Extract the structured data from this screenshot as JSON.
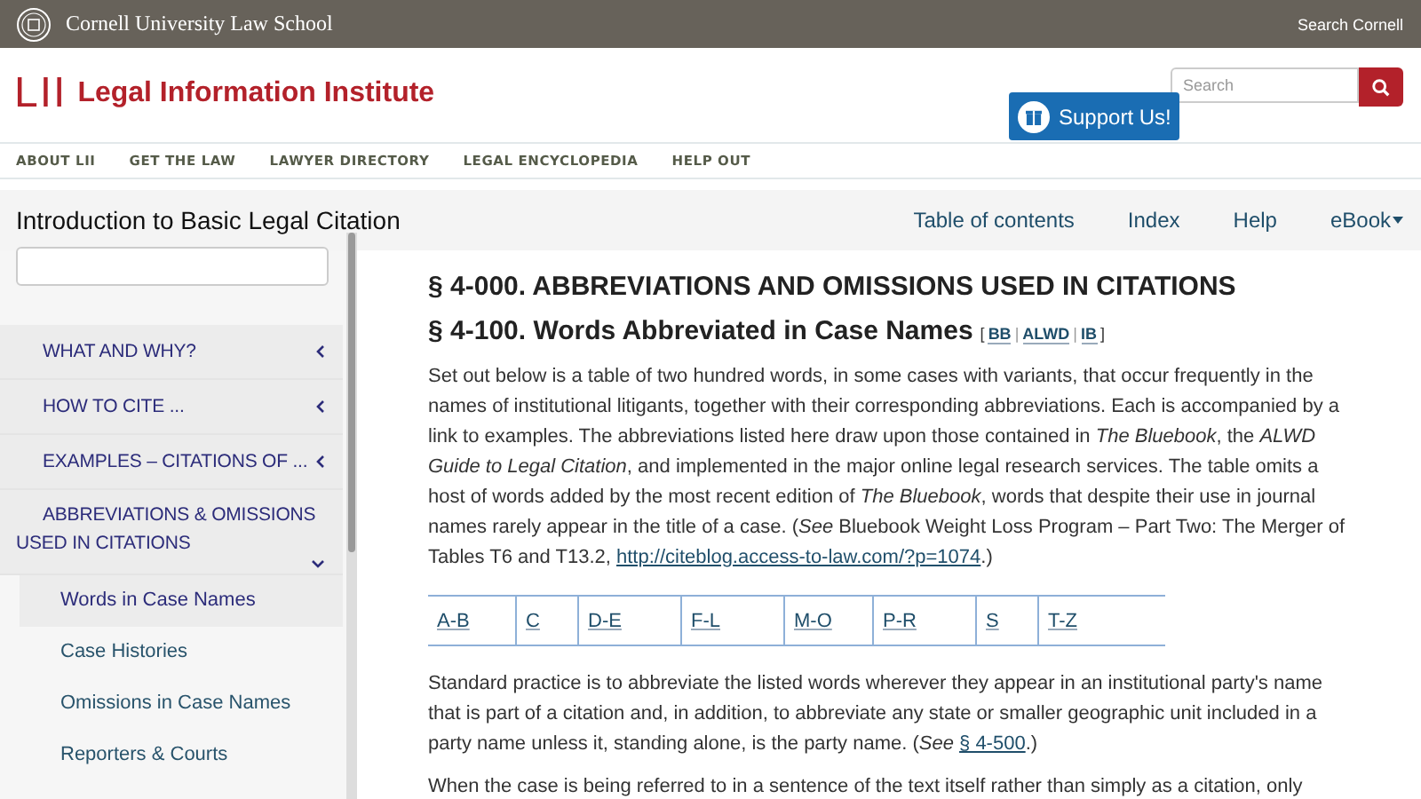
{
  "topbar": {
    "school": "Cornell University Law School",
    "search_link": "Search Cornell"
  },
  "header": {
    "logo_mark": "LII",
    "site_name": "Legal Information Institute",
    "search": {
      "placeholder": "Search"
    },
    "support_button": "Support Us!"
  },
  "nav": [
    "ABOUT LII",
    "GET THE LAW",
    "LAWYER DIRECTORY",
    "LEGAL ENCYCLOPEDIA",
    "HELP OUT"
  ],
  "book": {
    "title": "Introduction to Basic Legal Citation",
    "links": [
      "Table of contents",
      "Index",
      "Help",
      "eBook"
    ]
  },
  "sidebar": {
    "items": [
      {
        "label": "WHAT AND WHY?",
        "expanded": false
      },
      {
        "label": "HOW TO CITE ...",
        "expanded": false
      },
      {
        "label": "EXAMPLES – CITATIONS OF ...",
        "expanded": false
      },
      {
        "label": "ABBREVIATIONS & OMISSIONS USED IN CITATIONS",
        "expanded": true,
        "children": [
          {
            "label": "Words in Case Names",
            "selected": true
          },
          {
            "label": "Case Histories",
            "selected": false
          },
          {
            "label": "Omissions in Case Names",
            "selected": false
          },
          {
            "label": "Reporters & Courts",
            "selected": false
          }
        ]
      }
    ]
  },
  "content": {
    "heading": "§ 4-000. ABBREVIATIONS AND OMISSIONS USED IN CITATIONS",
    "subheading": "§ 4-100. Words Abbreviated in Case Names",
    "refs_open": "[",
    "refs": [
      {
        "label": "BB"
      },
      {
        "separator": "|",
        "label": "ALWD"
      },
      {
        "separator": "|",
        "label": "IB"
      }
    ],
    "refs_close": "]",
    "paragraphs": [
      [
        {
          "kind": "text",
          "text": "Set out below is a table of two hundred words, in some cases with variants, that occur frequently in the names of institutional litigants, together with their corresponding abbreviations. Each is accompanied by a link to examples. The abbreviations listed here draw upon those contained in *The Bluebook*, the *ALWD Guide to Legal Citation*, and implemented in the major online legal research services. The table omits a host of words added by the most recent edition of *The Bluebook*, words that despite their use in journal names rarely appear in the title of a case. (*See* Bluebook Weight Loss Program – Part Two: The Merger of Tables T6 and T13.2, "
        },
        {
          "kind": "link",
          "text": "http://citeblog.access-to-law.com/?p=1074"
        },
        {
          "kind": "text",
          "text": ".)"
        }
      ]
    ],
    "letter_tabs": [
      "A-B",
      "C",
      "D-E",
      "F-L",
      "M-O",
      "P-R",
      "S",
      "T-Z"
    ],
    "paragraphs_after": [
      [
        {
          "kind": "text",
          "text": "Standard practice is to abbreviate the listed words wherever they appear in an institutional party's name that is part of a citation and, in addition, to abbreviate any state or smaller geographic unit included in a party name unless it, standing alone, is the party name. (*See* "
        },
        {
          "kind": "link",
          "text": "§ 4-500"
        },
        {
          "kind": "text",
          "text": ".)"
        }
      ],
      [
        {
          "kind": "text",
          "text": "When the case is being referred to in a sentence of the text itself rather than simply as a citation, only"
        }
      ]
    ]
  }
}
